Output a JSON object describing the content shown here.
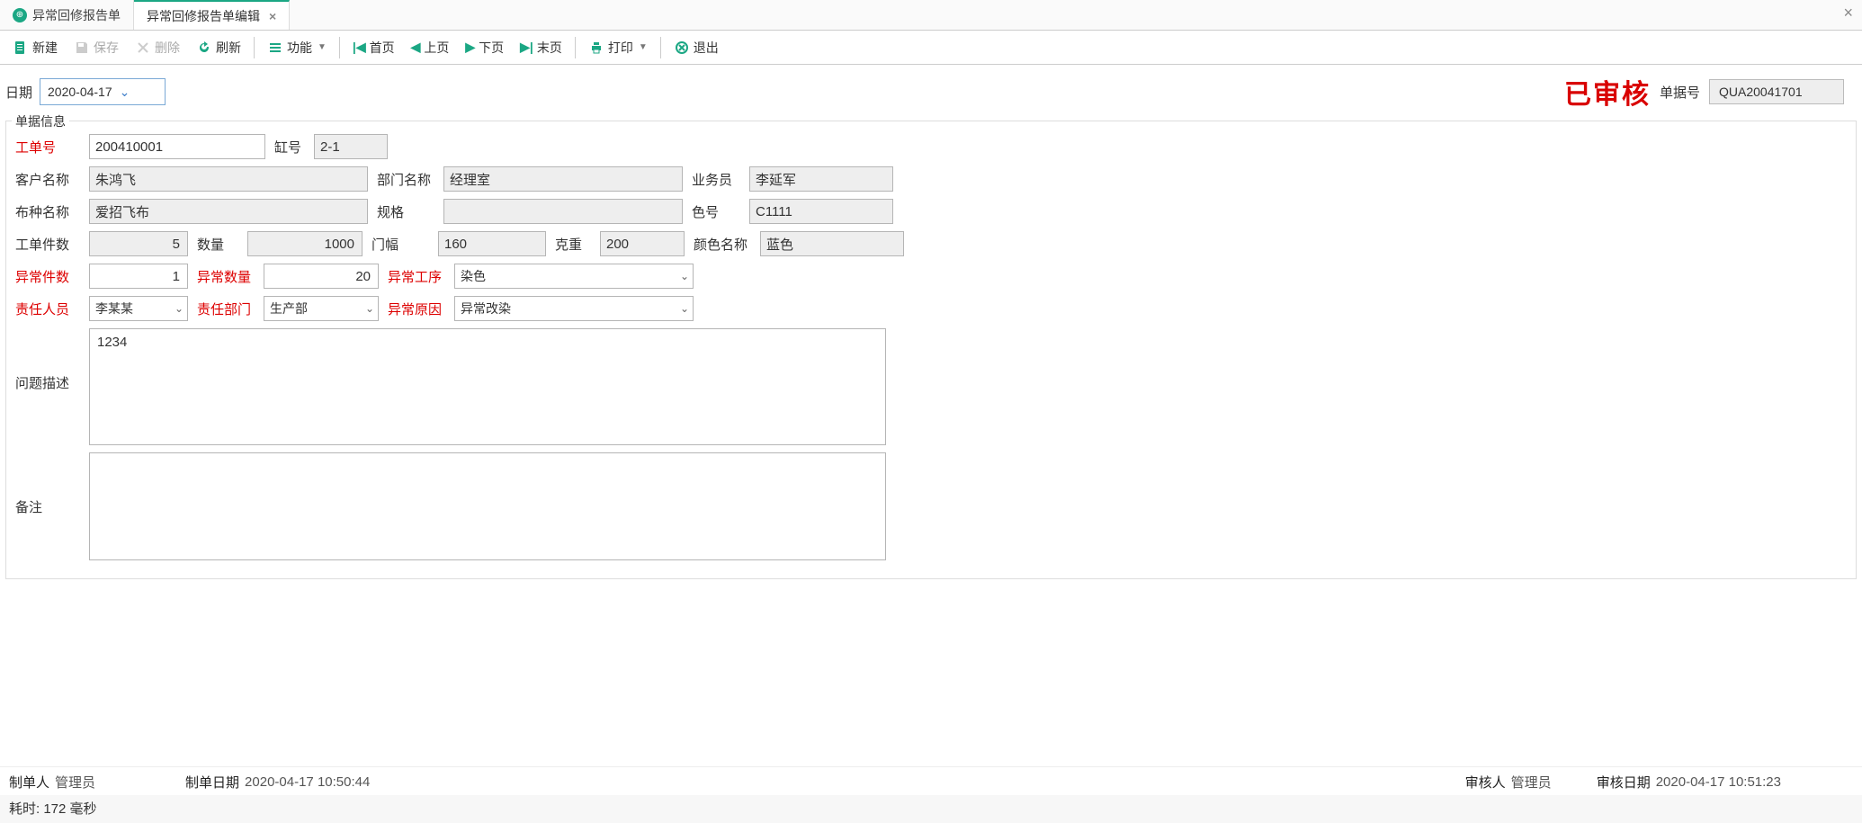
{
  "tabs": {
    "tab1": "异常回修报告单",
    "tab2": "异常回修报告单编辑"
  },
  "toolbar": {
    "new_label": "新建",
    "save_label": "保存",
    "delete_label": "删除",
    "refresh_label": "刷新",
    "func_label": "功能",
    "first_label": "首页",
    "prev_label": "上页",
    "next_label": "下页",
    "last_label": "末页",
    "print_label": "打印",
    "exit_label": "退出"
  },
  "header": {
    "date_label": "日期",
    "date_value": "2020-04-17",
    "stamp": "已审核",
    "docno_label": "单据号",
    "docno_value": "QUA20041701"
  },
  "group": {
    "title": "单据信息",
    "work_order_label": "工单号",
    "work_order": "200410001",
    "tank_label": "缸号",
    "tank": "2-1",
    "customer_label": "客户名称",
    "customer": "朱鸿飞",
    "dept_label": "部门名称",
    "dept": "经理室",
    "salesman_label": "业务员",
    "salesman": "李延军",
    "fabric_label": "布种名称",
    "fabric": "爱招飞布",
    "spec_label": "规格",
    "spec": "",
    "colorno_label": "色号",
    "colorno": "C1111",
    "wo_pcs_label": "工单件数",
    "wo_pcs": "5",
    "qty_label": "数量",
    "qty": "1000",
    "width_label": "门幅",
    "width": "160",
    "weight_label": "克重",
    "weight": "200",
    "colorname_label": "颜色名称",
    "colorname": "蓝色",
    "ab_pcs_label": "异常件数",
    "ab_pcs": "1",
    "ab_qty_label": "异常数量",
    "ab_qty": "20",
    "ab_proc_label": "异常工序",
    "ab_proc": "染色",
    "resp_person_label": "责任人员",
    "resp_person": "李某某",
    "resp_dept_label": "责任部门",
    "resp_dept": "生产部",
    "ab_reason_label": "异常原因",
    "ab_reason": "异常改染",
    "desc_label": "问题描述",
    "desc": "1234",
    "remark_label": "备注",
    "remark": ""
  },
  "footer": {
    "creator_label": "制单人",
    "creator": "管理员",
    "create_date_label": "制单日期",
    "create_date": "2020-04-17 10:50:44",
    "auditor_label": "审核人",
    "auditor": "管理员",
    "audit_date_label": "审核日期",
    "audit_date": "2020-04-17 10:51:23"
  },
  "status": "耗时: 172 毫秒"
}
